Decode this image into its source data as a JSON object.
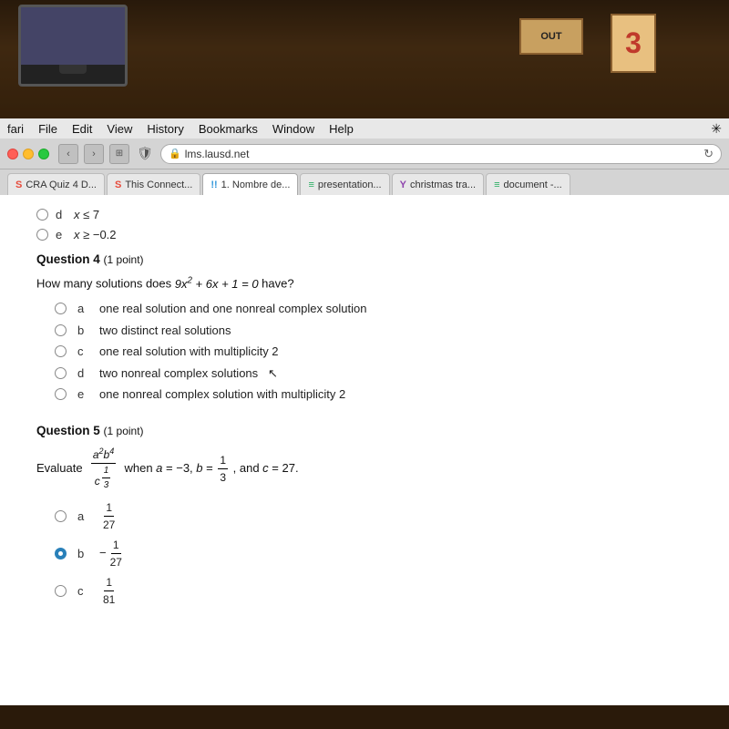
{
  "photo": {
    "monitor_label": "OUT",
    "number": "3"
  },
  "browser": {
    "menu_items": [
      "fari",
      "File",
      "Edit",
      "View",
      "History",
      "Bookmarks",
      "Window",
      "Help"
    ],
    "url": "lms.lausd.net",
    "tabs": [
      {
        "label": "CRA Quiz 4 D...",
        "icon": "S",
        "type": "s",
        "active": false
      },
      {
        "label": "This Connect...",
        "icon": "S",
        "type": "s",
        "active": false
      },
      {
        "label": "1. Nombre de...",
        "icon": "!!",
        "type": "exclaim",
        "active": true
      },
      {
        "label": "presentation...",
        "icon": "≡",
        "type": "lines",
        "active": false
      },
      {
        "label": "christmas tra...",
        "icon": "Y",
        "type": "y",
        "active": false
      },
      {
        "label": "document -...",
        "icon": "≡",
        "type": "lines",
        "active": false
      }
    ]
  },
  "content": {
    "prev_options": [
      {
        "label": "d",
        "text": "x ≤ 7"
      },
      {
        "label": "e",
        "text": "x ≥ −0.2"
      }
    ],
    "question4": {
      "title": "Question 4",
      "points": "(1 point)",
      "text": "How many solutions does 9x² + 6x + 1 = 0 have?",
      "options": [
        {
          "label": "a",
          "text": "one real solution and one nonreal complex solution"
        },
        {
          "label": "b",
          "text": "two distinct real solutions"
        },
        {
          "label": "c",
          "text": "one real solution with multiplicity 2"
        },
        {
          "label": "d",
          "text": "two nonreal complex solutions"
        },
        {
          "label": "e",
          "text": "one nonreal complex solution with multiplicity 2"
        }
      ]
    },
    "question5": {
      "title": "Question 5",
      "points": "(1 point)",
      "text_prefix": "Evaluate",
      "expression": "a²b⁴ / c^(1/3)",
      "text_suffix": "when a = −3, b = 1/3, and c = 27.",
      "options": [
        {
          "label": "a",
          "text": "1/27",
          "selected": false
        },
        {
          "label": "b",
          "text": "−1/27",
          "selected": true
        },
        {
          "label": "c",
          "text": "1/81",
          "selected": false
        }
      ]
    }
  }
}
